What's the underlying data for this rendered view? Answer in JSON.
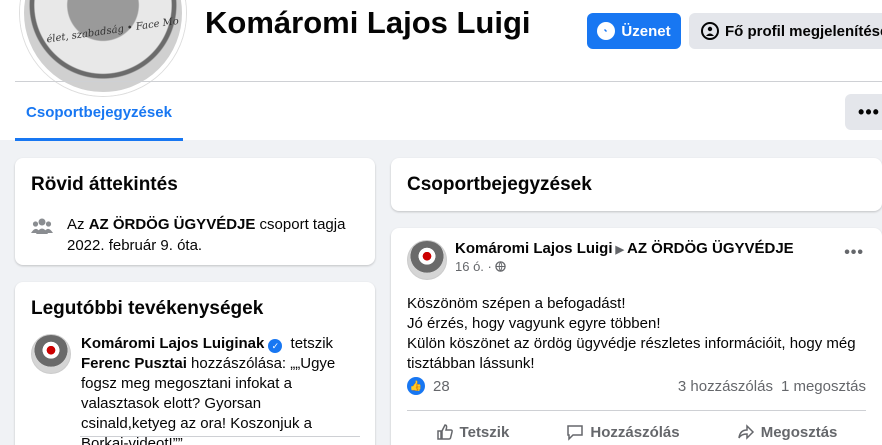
{
  "header": {
    "profile_name": "Komáromi Lajos Luigi",
    "avatar_ring_text": "élet, szabadság • Face Mo Fra...",
    "message_button": "Üzenet",
    "main_profile_button": "Fő profil megjelenítése"
  },
  "tabs": {
    "active": "Csoportbejegyzések",
    "more": "•••"
  },
  "about": {
    "title": "Rövid áttekintés",
    "membership_prefix": "Az ",
    "group_name": "AZ ÖRDÖG ÜGYVÉDJE",
    "membership_suffix": " csoport tagja 2022. február 9. óta."
  },
  "activity": {
    "title": "Legutóbbi tevékenységek",
    "actor": "Komáromi Lajos Luiginak",
    "verb": " tetszik",
    "target": "Ferenc Pusztai",
    "text": " hozzászólása: „„Ugye fogsz meg megosztani infokat a valasztasok elott? Gyorsan csinald,ketyeg az ora! Koszonjuk a Borkai-videot!””"
  },
  "posts_header": {
    "title": "Csoportbejegyzések"
  },
  "post": {
    "author": "Komáromi Lajos Luigi",
    "group": "AZ ÖRDÖG ÜGYVÉDJE",
    "time": "16 ó.",
    "lines": [
      "Köszönöm szépen a befogadást!",
      "Jó érzés, hogy vagyunk egyre többen!",
      "Külön köszönet az ördög ügyvédje részletes információit,  hogy még tisztábban lássunk!"
    ],
    "reactions_count": "28",
    "comments": "3 hozzászólás",
    "shares": "1 megosztás",
    "actions": {
      "like": "Tetszik",
      "comment": "Hozzászólás",
      "share": "Megosztás"
    }
  },
  "colors": {
    "accent": "#1877f2",
    "secondary_text": "#65676b",
    "background": "#f0f2f5"
  }
}
